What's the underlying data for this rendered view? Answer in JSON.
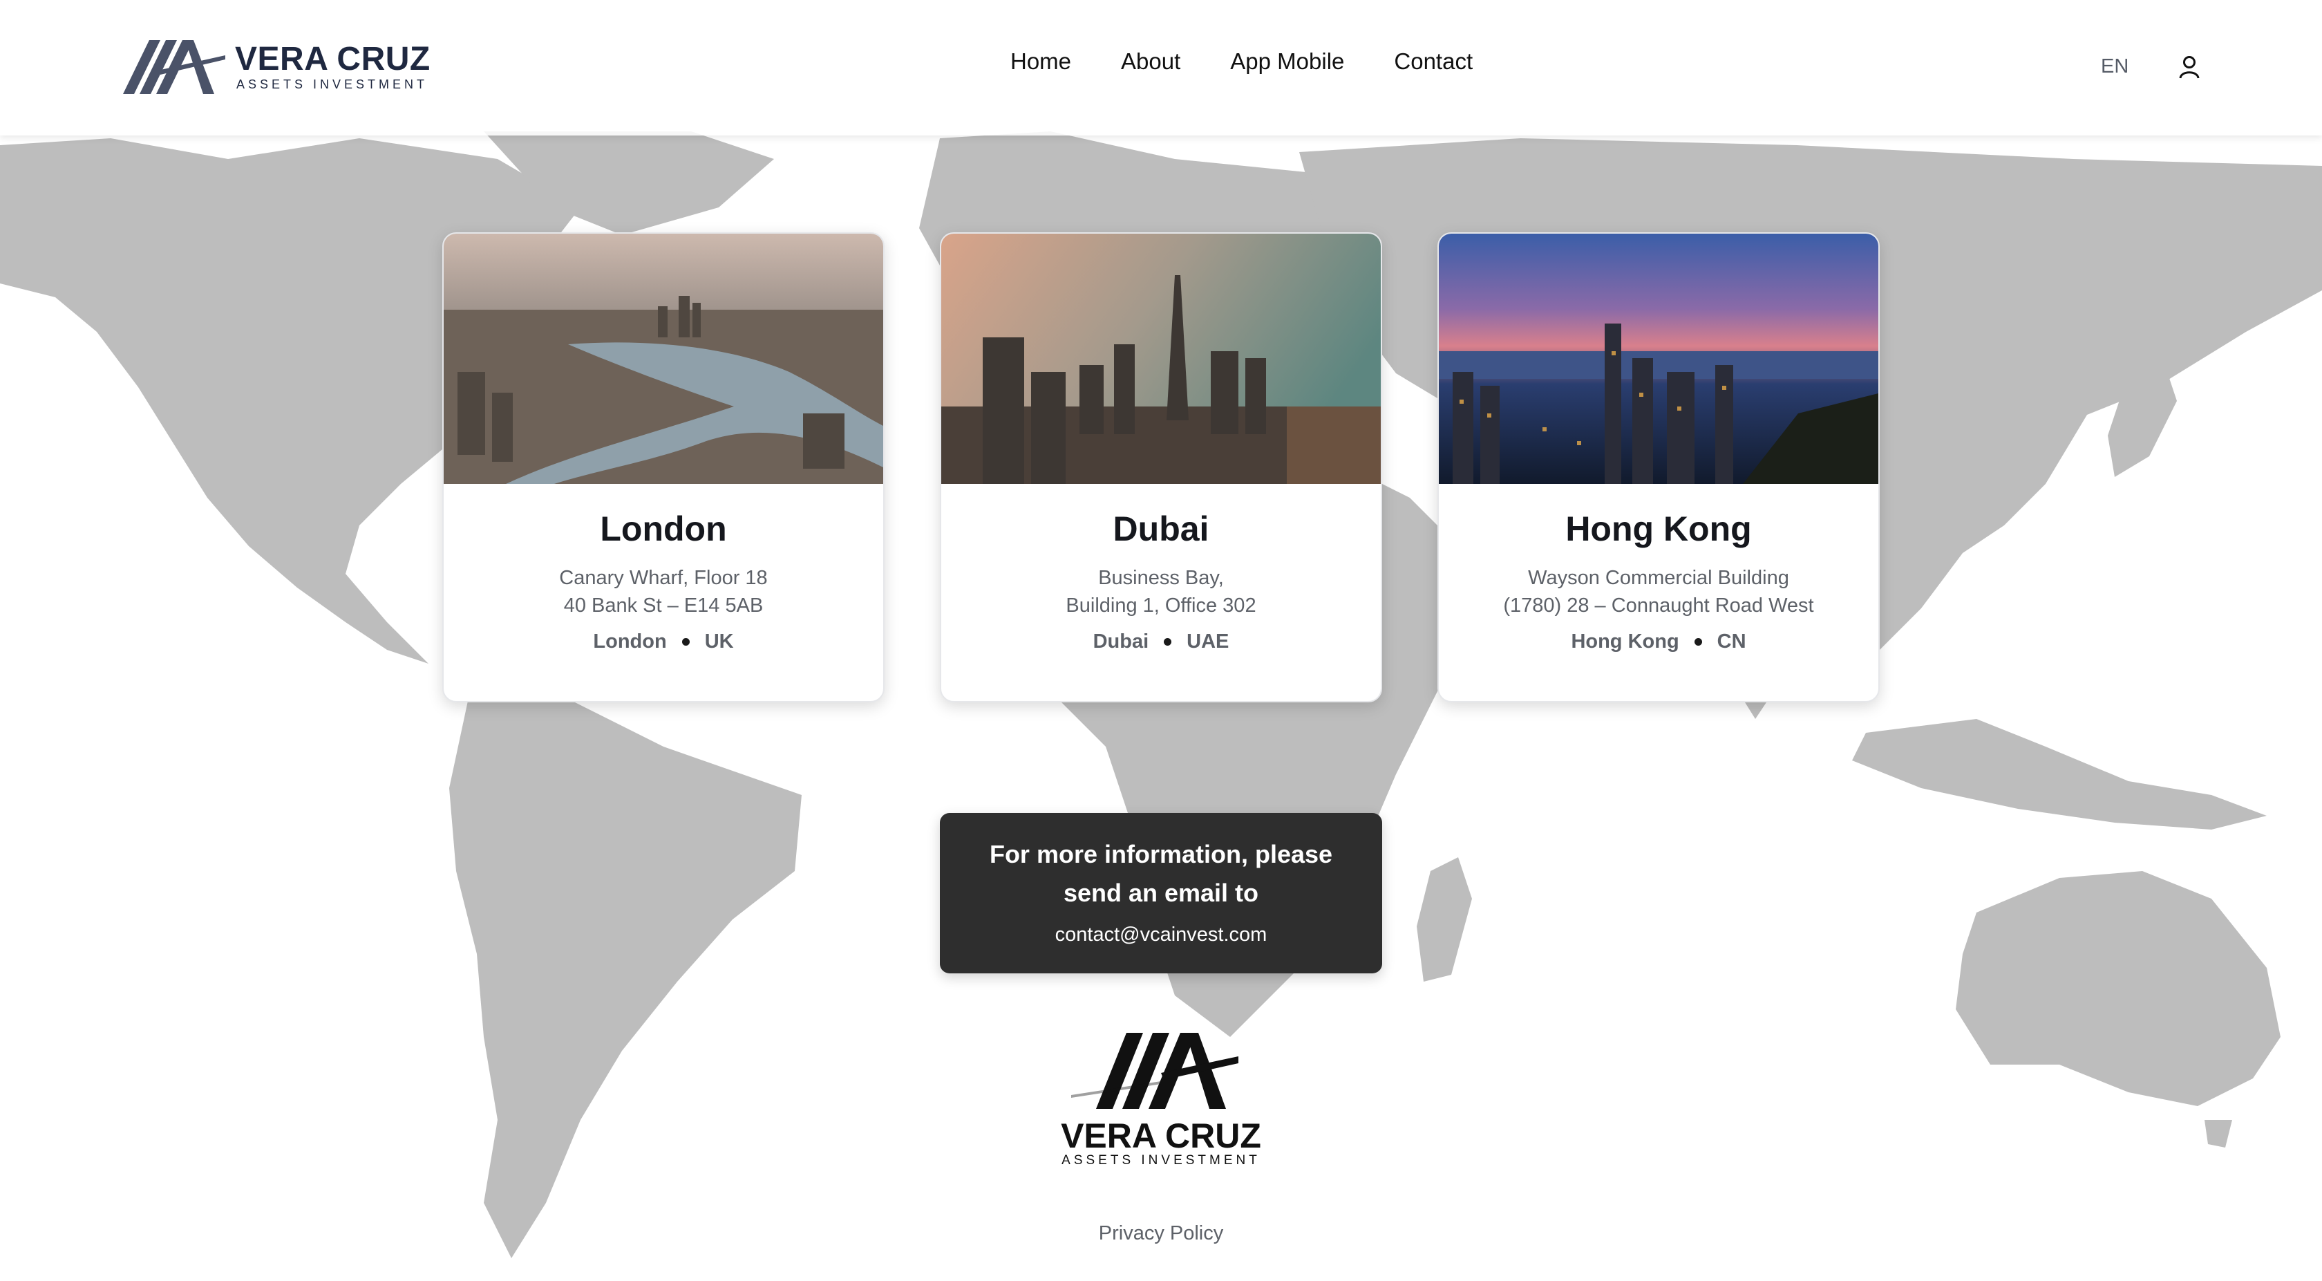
{
  "header": {
    "brand": "VERA CRUZ",
    "tagline": "ASSETS INVESTMENT",
    "nav": [
      "Home",
      "About",
      "App Mobile",
      "Contact"
    ],
    "language": "EN"
  },
  "offices": [
    {
      "title": "London",
      "address_line1": "Canary Wharf, Floor 18",
      "address_line2": "40 Bank St – E14 5AB",
      "city": "London",
      "country": "UK"
    },
    {
      "title": "Dubai",
      "address_line1": "Business Bay,",
      "address_line2": "Building 1, Office 302",
      "city": "Dubai",
      "country": "UAE"
    },
    {
      "title": "Hong Kong",
      "address_line1": "Wayson Commercial Building",
      "address_line2": "(1780) 28 – Connaught Road West",
      "city": "Hong Kong",
      "country": "CN"
    }
  ],
  "contact": {
    "message": "For more information, please send an email to",
    "email": "contact@vcainvest.com"
  },
  "footer": {
    "brand": "VERA CRUZ",
    "tagline": "ASSETS INVESTMENT",
    "privacy": "Privacy Policy"
  },
  "colors": {
    "brand_navy": "#1f2840",
    "map_land": "#bdbdbd",
    "contact_box": "#2e2e2e"
  }
}
